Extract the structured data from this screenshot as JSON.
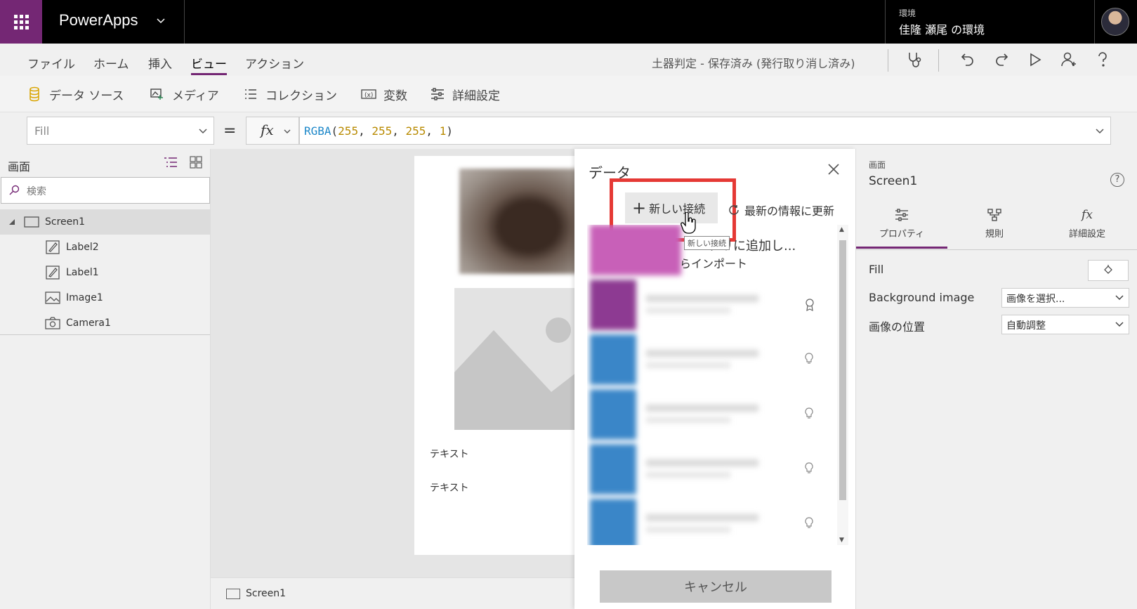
{
  "header": {
    "app_name": "PowerApps",
    "env_label": "環境",
    "env_name": "佳隆 瀬尾 の環境"
  },
  "menu": {
    "items": [
      "ファイル",
      "ホーム",
      "挿入",
      "ビュー",
      "アクション"
    ],
    "active": "ビュー",
    "app_status": "土器判定 - 保存済み (発行取り消し済み)"
  },
  "ribbon": {
    "data_source": "データ ソース",
    "media": "メディア",
    "collections": "コレクション",
    "variables": "変数",
    "advanced": "詳細設定"
  },
  "formula": {
    "property": "Fill",
    "equals": "=",
    "fx": "fx",
    "fn": "RGBA",
    "open": "(",
    "a1": "255",
    "a2": "255",
    "a3": "255",
    "a4": "1",
    "sep": ", ",
    "close": ")"
  },
  "tree": {
    "title": "画面",
    "search_placeholder": "検索",
    "items": [
      "Screen1",
      "Label2",
      "Label1",
      "Image1",
      "Camera1"
    ]
  },
  "canvas": {
    "label1": "テキスト",
    "label2": "テキスト",
    "status_screen": "Screen1"
  },
  "data_pane": {
    "title": "データ",
    "new_connection": "新しい接続",
    "refresh": "最新の情報に更新",
    "tooltip": "新しい接続",
    "first_item_line1": "プリに追加し...",
    "first_item_line2": "らインポート",
    "cancel": "キャンセル"
  },
  "properties": {
    "kind": "画面",
    "name": "Screen1",
    "help": "?",
    "tabs": [
      "プロパティ",
      "規則",
      "詳細設定"
    ],
    "fill_label": "Fill",
    "bg_image_label": "Background image",
    "bg_image_value": "画像を選択...",
    "image_position_label": "画像の位置",
    "image_position_value": "自動調整"
  },
  "colors": {
    "accent": "#742774",
    "highlight": "#e53935",
    "formula_fn": "#1e88c9",
    "formula_num": "#b88a00"
  }
}
